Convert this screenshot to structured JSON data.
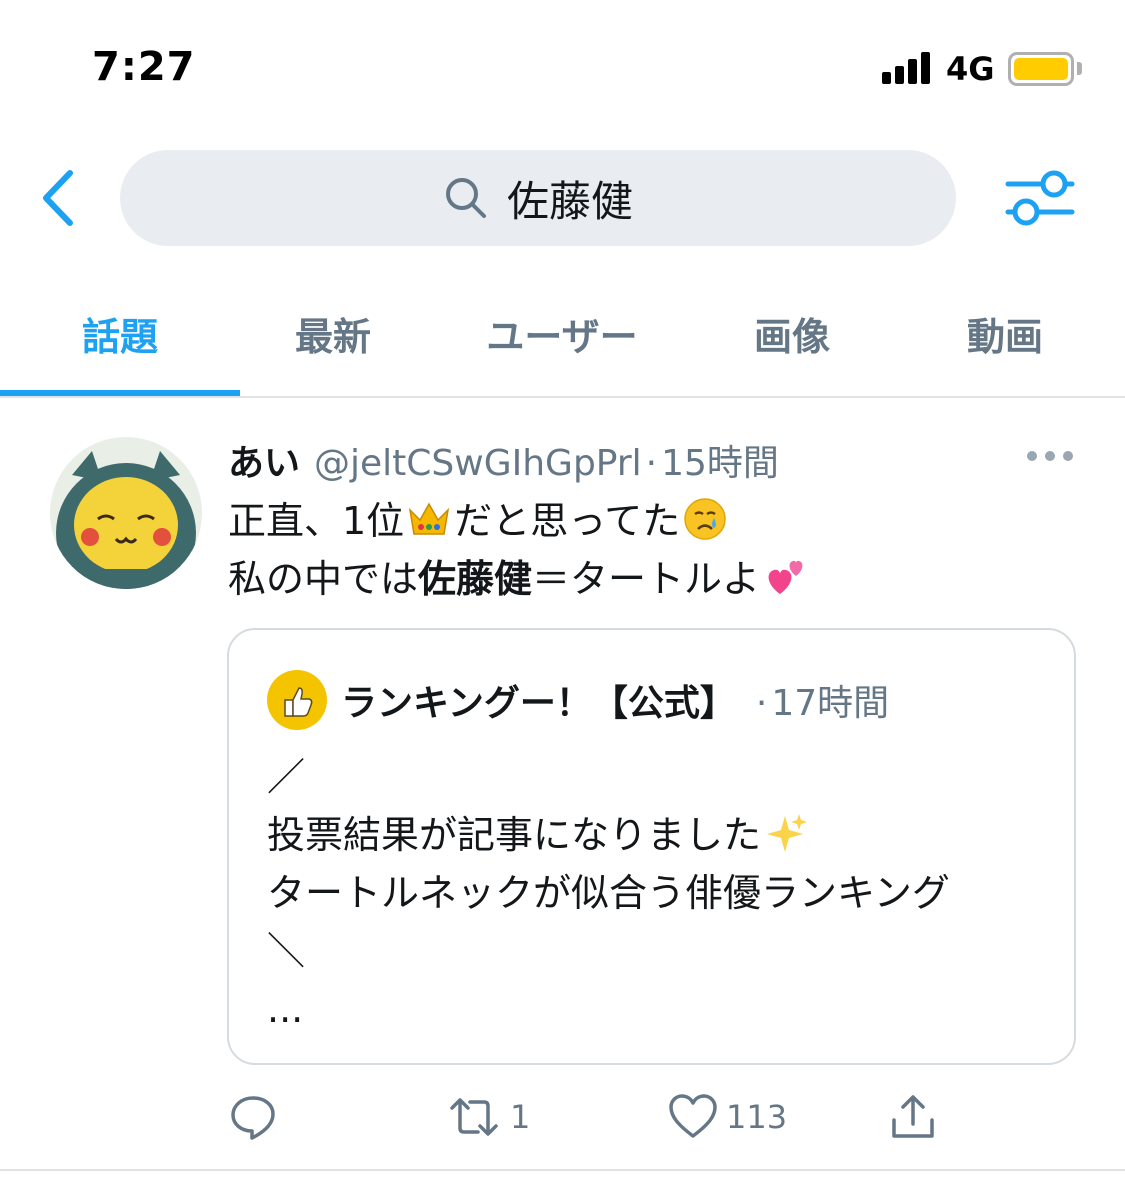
{
  "status_bar": {
    "time": "7:27",
    "network": "4G",
    "battery_color": "#ffcc00"
  },
  "search": {
    "query": "佐藤健",
    "icon": "search-icon",
    "bg_color": "#e9edf1"
  },
  "accent_color": "#1da1f2",
  "tabs": [
    {
      "label": "話題",
      "active": true
    },
    {
      "label": "最新",
      "active": false
    },
    {
      "label": "ユーザー",
      "active": false
    },
    {
      "label": "画像",
      "active": false
    },
    {
      "label": "動画",
      "active": false
    }
  ],
  "tweet": {
    "author_name": "あい",
    "author_handle": "@jeltCSwGIhGpPrl",
    "separator": "·",
    "time": "15時間",
    "text_line1_a": "正直、1位",
    "text_line1_emoji1": "👑",
    "text_line1_b": "だと思ってた",
    "text_line1_emoji2": "😢",
    "text_line2_a": "私の中では",
    "text_line2_bold": "佐藤健",
    "text_line2_b": "＝タートルよ",
    "text_line2_emoji": "💕",
    "quote": {
      "author_name": "ランキングー！【公式】",
      "separator": "·",
      "time": "17時間",
      "lines": [
        "／",
        "投票結果が記事になりました",
        "タートルネックが似合う俳優ランキング",
        "＼",
        "..."
      ],
      "line2_emoji": "✨"
    },
    "actions": {
      "reply_count": "",
      "retweet_count": "1",
      "like_count": "113"
    }
  }
}
